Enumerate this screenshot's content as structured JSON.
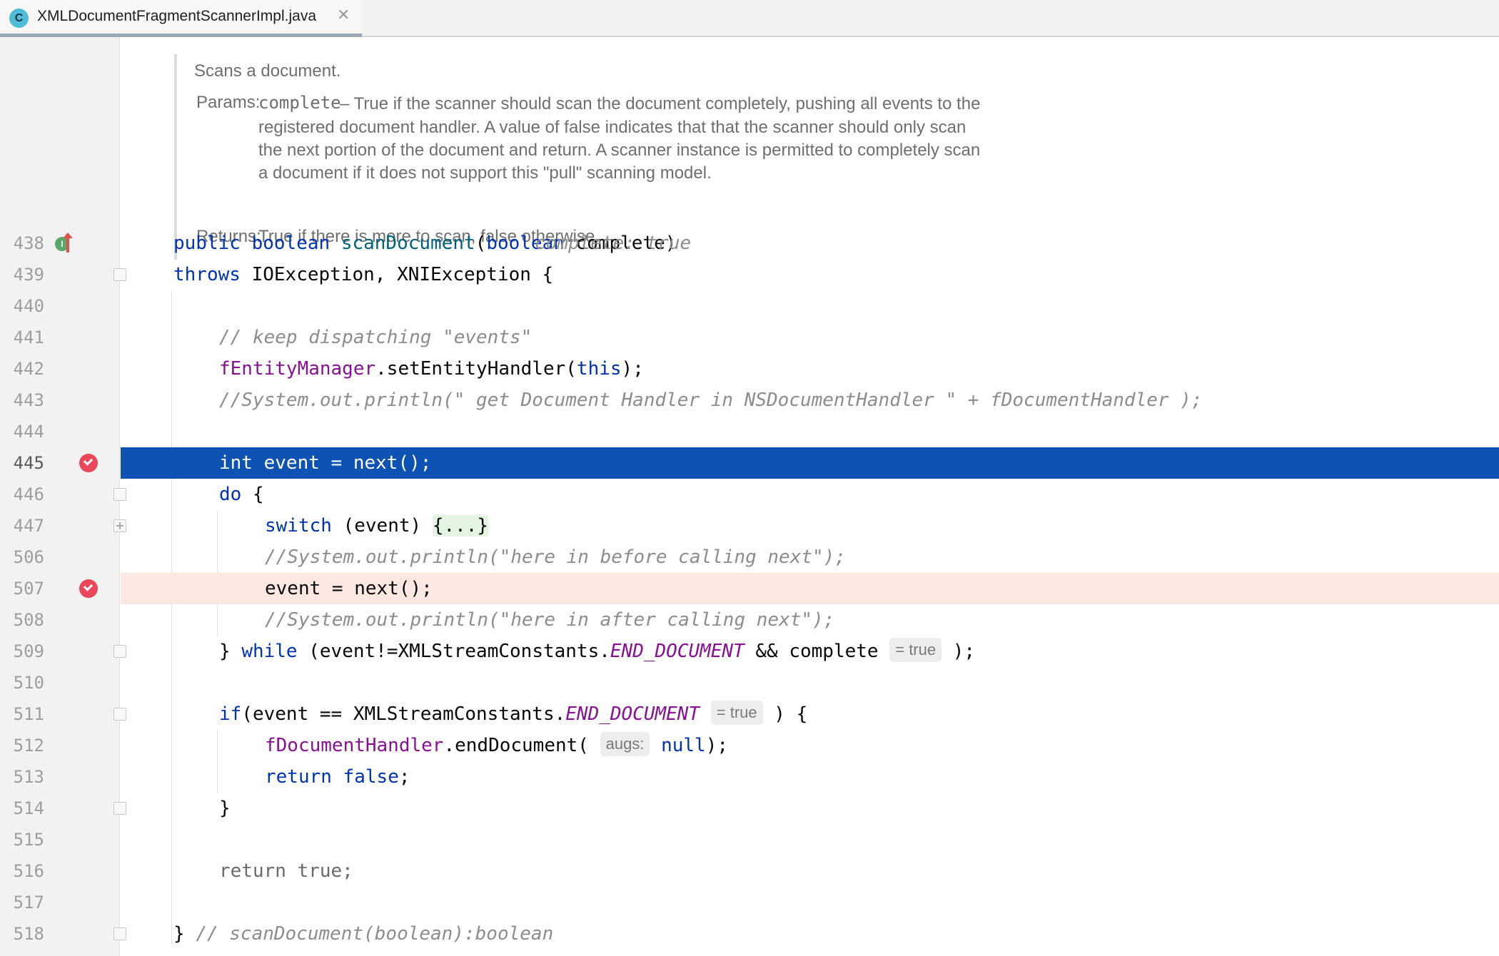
{
  "tab": {
    "icon_letter": "C",
    "title": "XMLDocumentFragmentScannerImpl.java",
    "close_glyph": "✕"
  },
  "javadoc": {
    "summary": "Scans a document.",
    "params_label": "Params:",
    "param_name": "complete",
    "param_desc_lines": [
      "– True if the scanner should scan the document completely, pushing all events to the",
      "registered document handler. A value of false indicates that that the scanner should only scan",
      "the next portion of the document and return. A scanner instance is permitted to completely scan",
      "a document if it does not support this \"pull\" scanning model."
    ],
    "returns_label": "Returns:",
    "returns_desc": "True if there is more to scan, false otherwise."
  },
  "lines": {
    "l438": {
      "num": "438",
      "kw1": "public",
      "kw2": "boolean",
      "fn": "scanDocument",
      "p1": "(",
      "kw3": "boolean",
      "p2": " complete)",
      "hint": "complete: true"
    },
    "l439": {
      "num": "439",
      "kw": "throws",
      "rest": " IOException, XNIException {"
    },
    "l440": {
      "num": "440"
    },
    "l441": {
      "num": "441",
      "comment": "// keep dispatching \"events\""
    },
    "l442": {
      "num": "442",
      "field": "fEntityManager",
      "p1": ".setEntityHandler(",
      "kw": "this",
      "p2": ");"
    },
    "l443": {
      "num": "443",
      "comment": "//System.out.println(\" get Document Handler in NSDocumentHandler \" + fDocumentHandler );"
    },
    "l444": {
      "num": "444"
    },
    "l445": {
      "num": "445",
      "code": "int event = next();"
    },
    "l446": {
      "num": "446",
      "kw": "do",
      "rest": " {"
    },
    "l447": {
      "num": "447",
      "kw": "switch",
      "rest": " (event) ",
      "folded": "{...}"
    },
    "l506": {
      "num": "506",
      "comment": "//System.out.println(\"here in before calling next\");"
    },
    "l507": {
      "num": "507",
      "code": "event = next();"
    },
    "l508": {
      "num": "508",
      "comment": "//System.out.println(\"here in after calling next\");"
    },
    "l509": {
      "num": "509",
      "p1": "} ",
      "kw": "while",
      "p2": " (event!=XMLStreamConstants.",
      "const": "END_DOCUMENT",
      "p3": " && complete",
      "inlay": "= true",
      "p4": " );"
    },
    "l510": {
      "num": "510"
    },
    "l511": {
      "num": "511",
      "kw": "if",
      "p1": "(event == XMLStreamConstants.",
      "const": "END_DOCUMENT",
      "inlay": "= true",
      "p2": " ) {"
    },
    "l512": {
      "num": "512",
      "field": "fDocumentHandler",
      "p1": ".endDocument(",
      "inlay": "augs:",
      "kw": "null",
      "p2": ");"
    },
    "l513": {
      "num": "513",
      "kw1": "return",
      "kw2": "false",
      "p": ";"
    },
    "l514": {
      "num": "514",
      "code": "}"
    },
    "l515": {
      "num": "515"
    },
    "l516": {
      "num": "516",
      "code": "return true;"
    },
    "l517": {
      "num": "517"
    },
    "l518": {
      "num": "518",
      "p": "} ",
      "comment": "// scanDocument(boolean):boolean"
    }
  },
  "colors": {
    "keyword": "#0033b3",
    "method": "#00627a",
    "field": "#871094",
    "comment": "#8c8c8c",
    "execution_line": "#0e52b3",
    "breakpoint": "#e8485a",
    "breakpoint_line": "#fce8e3"
  },
  "icons": {
    "file_icon": "java-class-icon",
    "breakpoint_icon": "verified-breakpoint-icon",
    "implements_icon": "implements-method-icon",
    "fold_icon": "fold-marker-icon"
  }
}
